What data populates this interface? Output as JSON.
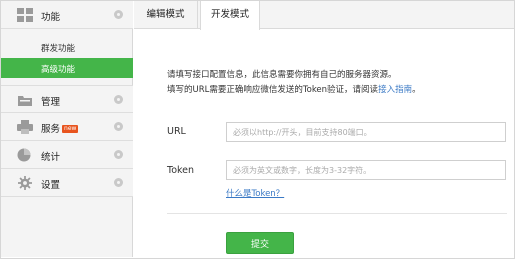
{
  "sidebar": {
    "groups": [
      {
        "label": "功能",
        "icon": "grid-icon"
      },
      {
        "label": "管理",
        "icon": "folder-icon"
      },
      {
        "label": "服务",
        "badge": "new",
        "icon": "printer-icon"
      },
      {
        "label": "统计",
        "icon": "pie-chart-icon"
      },
      {
        "label": "设置",
        "icon": "gear-icon"
      }
    ],
    "sub_items": [
      {
        "label": "群发功能"
      },
      {
        "label": "高级功能"
      }
    ]
  },
  "tabs": [
    {
      "label": "编辑模式"
    },
    {
      "label": "开发模式"
    }
  ],
  "intro": {
    "line1": "请填写接口配置信息，此信息需要你拥有自己的服务器资源。",
    "line2_prefix": "填写的URL需要正确响应微信发送的Token验证，请阅读",
    "line2_link": "接入指南",
    "line2_suffix": "。"
  },
  "form": {
    "url_label": "URL",
    "url_placeholder": "必须以http://开头，目前支持80端口。",
    "token_label": "Token",
    "token_placeholder": "必须为英文或数字，长度为3-32字符。",
    "token_help": "什么是Token？",
    "submit_label": "提交"
  },
  "colors": {
    "accent": "#44b549",
    "link": "#3a79c5",
    "badge": "#e8541e"
  }
}
